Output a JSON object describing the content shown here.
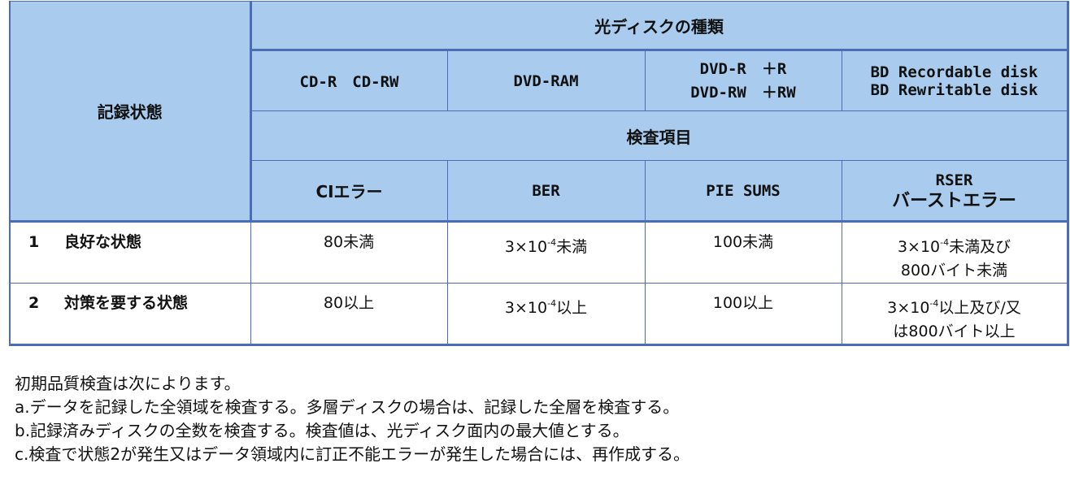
{
  "table": {
    "corner_header": "記録状態",
    "disc_type_header": "光ディスクの種類",
    "disc_types": [
      {
        "lines": [
          "CD-R　CD-RW"
        ]
      },
      {
        "lines": [
          "DVD-RAM"
        ]
      },
      {
        "lines": [
          "DVD-R　＋R",
          "DVD-RW　＋RW"
        ]
      },
      {
        "lines": [
          "BD Recordable disk",
          "BD Rewritable disk"
        ]
      }
    ],
    "inspection_header": "検査項目",
    "inspection_items": [
      {
        "lines": [
          "CIエラー"
        ]
      },
      {
        "lines": [
          "BER"
        ]
      },
      {
        "lines": [
          "PIE SUMS"
        ]
      },
      {
        "lines": [
          "RSER",
          "バーストエラー"
        ]
      }
    ],
    "rows": [
      {
        "num": "1",
        "label": "良好な状態",
        "ci": "80未満",
        "ber": {
          "base": "3×10",
          "exp": "-4",
          "suffix": "未満"
        },
        "pie": "100未満",
        "rser": {
          "base": "3×10",
          "exp": "-4",
          "suffix": "未満及び",
          "line2": "800バイト未満"
        }
      },
      {
        "num": "2",
        "label": "対策を要する状態",
        "ci": "80以上",
        "ber": {
          "base": "3×10",
          "exp": "-4",
          "suffix": "以上"
        },
        "pie": "100以上",
        "rser": {
          "base": "3×10",
          "exp": "-4",
          "suffix": "以上及び/又",
          "line2": "は800バイト以上"
        }
      }
    ]
  },
  "notes": [
    "初期品質検査は次によります。",
    "a.データを記録した全領域を検査する。多層ディスクの場合は、記録した全層を検査する。",
    "b.記録済みディスクの全数を検査する。検査値は、光ディスク面内の最大値とする。",
    "c.検査で状態2が発生又はデータ領域内に訂正不能エラーが発生した場合には、再作成する。"
  ],
  "colors": {
    "header_fill": "#a9cbee",
    "border": "#4a6db5"
  }
}
